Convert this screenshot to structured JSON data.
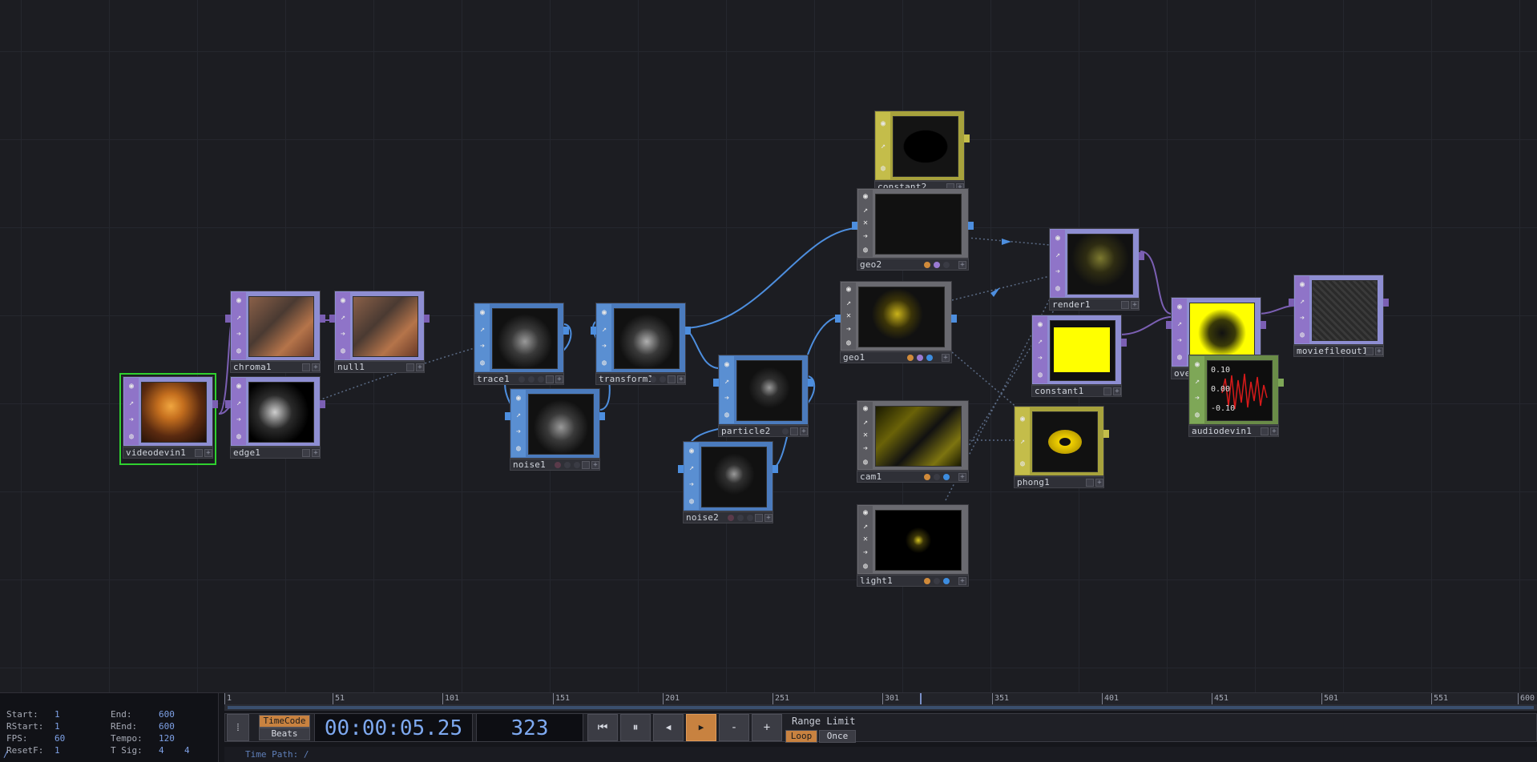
{
  "nodes": {
    "videodevin1": {
      "label": "videodevin1"
    },
    "chroma1": {
      "label": "chroma1"
    },
    "null1": {
      "label": "null1"
    },
    "edge1": {
      "label": "edge1"
    },
    "trace1": {
      "label": "trace1"
    },
    "noise1": {
      "label": "noise1"
    },
    "transform1": {
      "label": "transform1"
    },
    "particle2": {
      "label": "particle2"
    },
    "noise2": {
      "label": "noise2"
    },
    "constant2": {
      "label": "constant2"
    },
    "geo2": {
      "label": "geo2"
    },
    "geo1": {
      "label": "geo1"
    },
    "cam1": {
      "label": "cam1"
    },
    "light1": {
      "label": "light1"
    },
    "render1": {
      "label": "render1"
    },
    "constant1": {
      "label": "constant1"
    },
    "phong1": {
      "label": "phong1"
    },
    "over1": {
      "label": "over1"
    },
    "audiodevin1": {
      "label": "audiodevin1"
    },
    "moviefileout1": {
      "label": "moviefileout1"
    }
  },
  "audiodevin1_readout": {
    "top": "0.10",
    "mid": "0.00",
    "bottom": "-0.10"
  },
  "colors": {
    "top": "#8f74c8",
    "sop": "#4b7bbd",
    "comp": "#6a6a70",
    "mat": "#c4bd4a",
    "chop": "#7ea757",
    "wire_sop": "#4d8ede",
    "wire_top": "#7b5fb3",
    "selected": "#2fd12f"
  },
  "timeline": {
    "ruler_ticks": [
      "1",
      "51",
      "101",
      "151",
      "201",
      "251",
      "301",
      "351",
      "401",
      "451",
      "501",
      "551",
      "600"
    ],
    "playhead_frame": 323,
    "range_start": 1,
    "range_end": 600
  },
  "info": {
    "start_label": "Start:",
    "start": "1",
    "end_label": "End:",
    "end": "600",
    "rstart_label": "RStart:",
    "rstart": "1",
    "rend_label": "REnd:",
    "rend": "600",
    "fps_label": "FPS:",
    "fps": "60",
    "tempo_label": "Tempo:",
    "tempo": "120",
    "resetf_label": "ResetF:",
    "resetf": "1",
    "tsig_label": "T Sig:",
    "tsig_a": "4",
    "tsig_b": "4"
  },
  "controls": {
    "timecode_label": "TimeCode",
    "beats_label": "Beats",
    "time_display": "00:00:05.25",
    "frame_display": "323",
    "range_limit_label": "Range Limit",
    "loop_label": "Loop",
    "once_label": "Once",
    "minus_label": "-",
    "plus_label": "+"
  },
  "path": {
    "prefix": "/",
    "label": "Time Path: /"
  }
}
